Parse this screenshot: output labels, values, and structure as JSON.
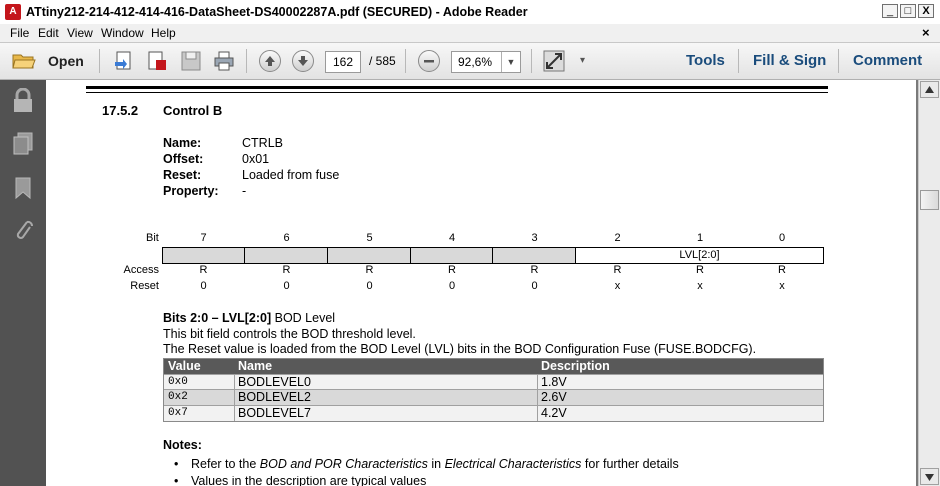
{
  "window": {
    "title": "ATtiny212-214-412-414-416-DataSheet-DS40002287A.pdf (SECURED) - Adobe Reader",
    "app_icon": "pdf-icon",
    "controls": {
      "minimize": "_",
      "maximize": "□",
      "close": "X"
    }
  },
  "menubar": {
    "items": [
      "File",
      "Edit",
      "View",
      "Window",
      "Help"
    ],
    "close": "×"
  },
  "toolbar": {
    "open_label": "Open",
    "page_current": "162",
    "page_total": "/ 585",
    "zoom": "92,6%",
    "tools_label": "Tools",
    "fill_sign_label": "Fill & Sign",
    "comment_label": "Comment"
  },
  "leftnav": {
    "icons": [
      "lock-icon",
      "pages-icon",
      "bookmark-icon",
      "paperclip-icon"
    ]
  },
  "document": {
    "section_number": "17.5.2",
    "section_title": "Control B",
    "props": [
      {
        "label": "Name:",
        "value": "CTRLB"
      },
      {
        "label": "Offset:",
        "value": "0x01"
      },
      {
        "label": "Reset:",
        "value": "Loaded from fuse"
      },
      {
        "label": "Property:",
        "value": "-"
      }
    ],
    "register": {
      "bit_label": "Bit",
      "bits": [
        "7",
        "6",
        "5",
        "4",
        "3",
        "2",
        "1",
        "0"
      ],
      "field_name": "LVL[2:0]",
      "access_label": "Access",
      "access": [
        "R",
        "R",
        "R",
        "R",
        "R",
        "R",
        "R",
        "R"
      ],
      "reset_label": "Reset",
      "reset": [
        "0",
        "0",
        "0",
        "0",
        "0",
        "x",
        "x",
        "x"
      ]
    },
    "bits_heading": "Bits 2:0 – LVL[2:0]",
    "bits_heading_desc": "BOD Level",
    "desc1": "This bit field controls the BOD threshold level.",
    "desc2": "The Reset value is loaded from the BOD Level (LVL) bits in the BOD Configuration Fuse (FUSE.BODCFG).",
    "table": {
      "headers": [
        "Value",
        "Name",
        "Description"
      ],
      "rows": [
        [
          "0x0",
          "BODLEVEL0",
          "1.8V"
        ],
        [
          "0x2",
          "BODLEVEL2",
          "2.6V"
        ],
        [
          "0x7",
          "BODLEVEL7",
          "4.2V"
        ]
      ]
    },
    "notes_heading": "Notes:",
    "note1_a": "Refer to the ",
    "note1_b": "BOD and POR Characteristics",
    "note1_c": " in ",
    "note1_d": "Electrical Characteristics",
    "note1_e": " for further details",
    "note2": "Values in the description are typical values"
  }
}
